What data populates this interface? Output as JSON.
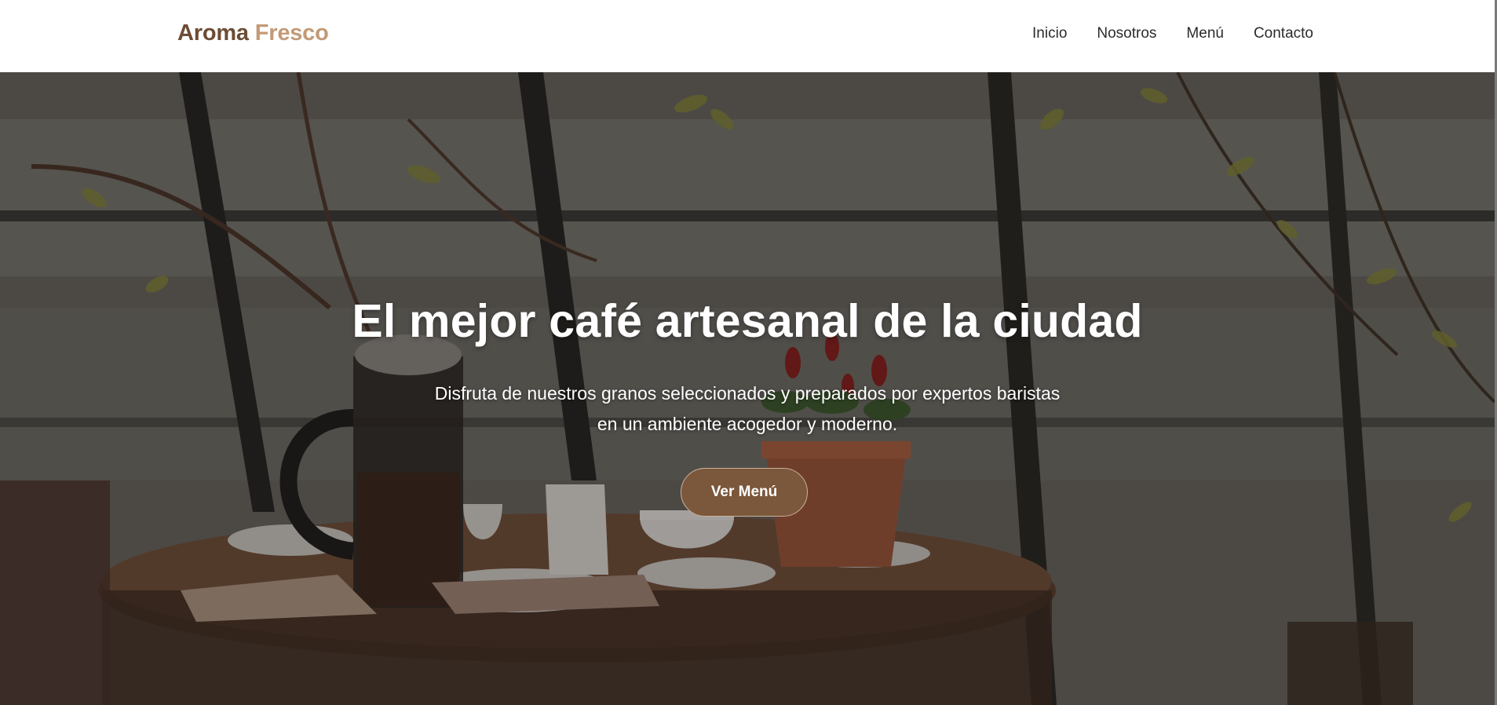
{
  "header": {
    "logo_part1": "Aroma",
    "logo_part2": "Fresco",
    "nav": [
      "Inicio",
      "Nosotros",
      "Menú",
      "Contacto"
    ]
  },
  "hero": {
    "title": "El mejor café artesanal de la ciudad",
    "subtitle": "Disfruta de nuestros granos seleccionados y preparados por expertos baristas en un ambiente acogedor y moderno.",
    "button_label": "Ver Menú",
    "background_image": "coffee-table-photo"
  },
  "colors": {
    "brand_dark": "#6d4c34",
    "brand_light": "#c39a77",
    "button_bg": "#7b573b"
  }
}
